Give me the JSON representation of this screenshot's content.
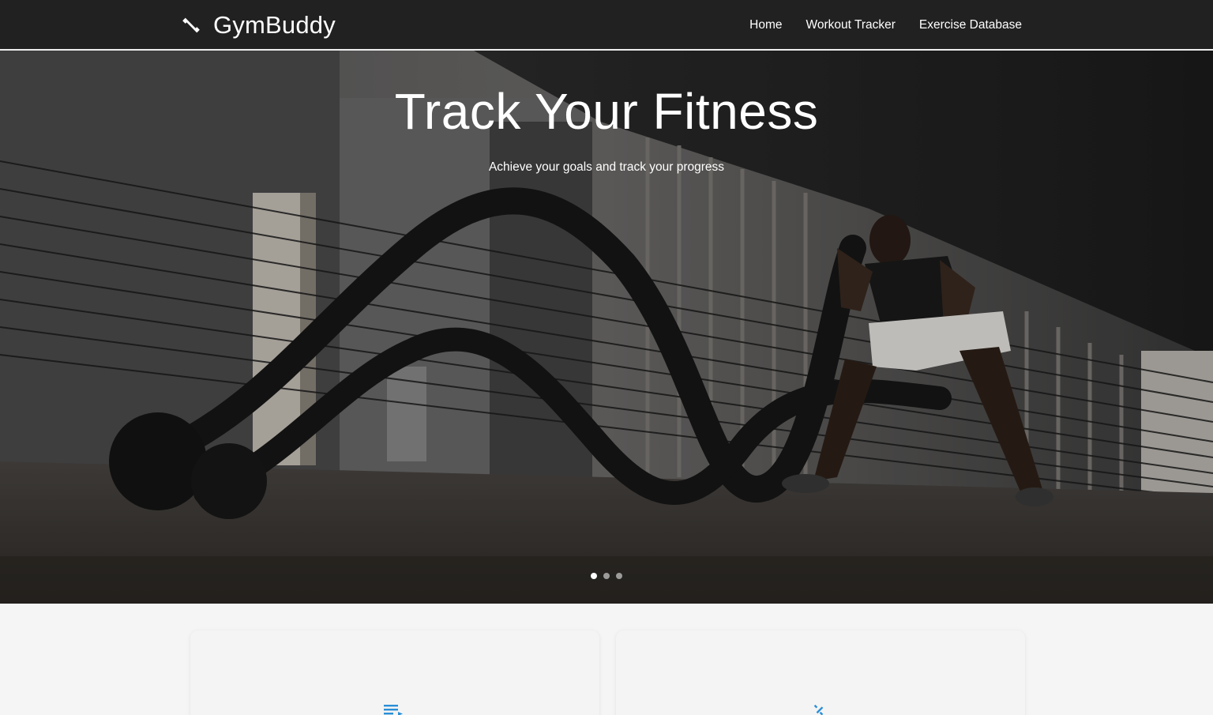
{
  "brand": {
    "name": "GymBuddy",
    "icon": "dumbbell-icon"
  },
  "nav": {
    "items": [
      {
        "label": "Home"
      },
      {
        "label": "Workout Tracker"
      },
      {
        "label": "Exercise Database"
      }
    ]
  },
  "hero": {
    "title": "Track Your Fitness",
    "subtitle": "Achieve your goals and track your progress",
    "slides_count": 3,
    "active_slide": 1
  },
  "cards": [
    {
      "icon": "list-icon",
      "icon_color": "#2a8fd6"
    },
    {
      "icon": "dumbbell-icon",
      "icon_color": "#2a8fd6"
    }
  ],
  "colors": {
    "navbar": "#212121",
    "accent": "#2a8fd6",
    "page_bg": "#f5f5f5"
  }
}
